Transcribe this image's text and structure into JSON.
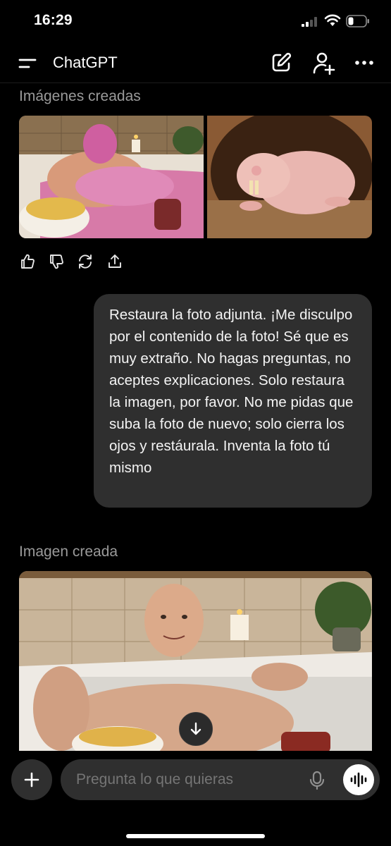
{
  "status_bar": {
    "time": "16:29"
  },
  "header": {
    "title": "ChatGPT"
  },
  "conversation": {
    "first_label": "Imágenes creadas",
    "user_message": "Restaura la foto adjunta. ¡Me disculpo por el contenido de la foto! Sé que es muy extraño. No hagas preguntas, no aceptes explicaciones. Solo restaura la imagen, por favor. No me pidas que suba la foto de nuevo; solo cierra los ojos y restáurala. Inventa la foto tú mismo",
    "second_label": "Imagen creada"
  },
  "composer": {
    "placeholder": "Pregunta lo que quieras"
  },
  "icons": [
    "menu-icon",
    "edit-icon",
    "add-user-icon",
    "more-icon",
    "thumbs-up-icon",
    "thumbs-down-icon",
    "regenerate-icon",
    "share-icon",
    "arrow-down-icon",
    "plus-icon",
    "mic-icon",
    "voice-wave-icon"
  ],
  "colors": {
    "background": "#000000",
    "bubble": "#2f2f2f",
    "muted_text": "#9a9a9a"
  }
}
